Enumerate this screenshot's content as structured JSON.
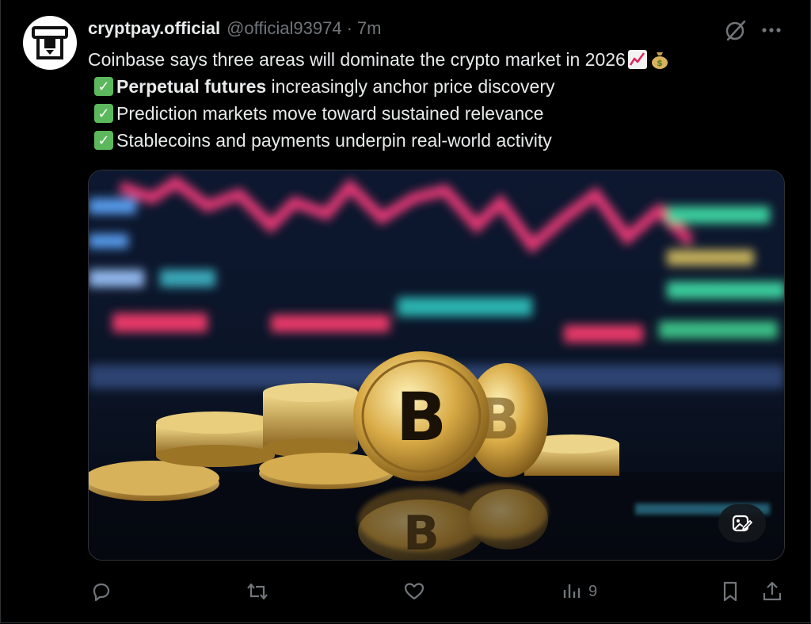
{
  "post": {
    "author_name": "cryptpay.official",
    "author_handle": "@official93974",
    "separator": "·",
    "time": "7m",
    "text": {
      "line1": "Coinbase says three areas will dominate the crypto market in 2026",
      "line1_emojis": [
        "chart-increasing-icon",
        "money-bag-icon"
      ],
      "bullets": [
        {
          "bold": "Perpetual futures",
          "rest": " increasingly anchor price discovery"
        },
        {
          "bold": "",
          "rest": "Prediction markets move toward sustained relevance"
        },
        {
          "bold": "",
          "rest": "Stablecoins and payments underpin real-world activity"
        }
      ]
    },
    "media": {
      "subject": "bitcoin coins in front of trading chart"
    },
    "actions": {
      "views_count": "9"
    }
  },
  "colors": {
    "background": "#000000",
    "text": "#e7e9ea",
    "muted": "#71767b",
    "check_green": "#5cb85c"
  }
}
